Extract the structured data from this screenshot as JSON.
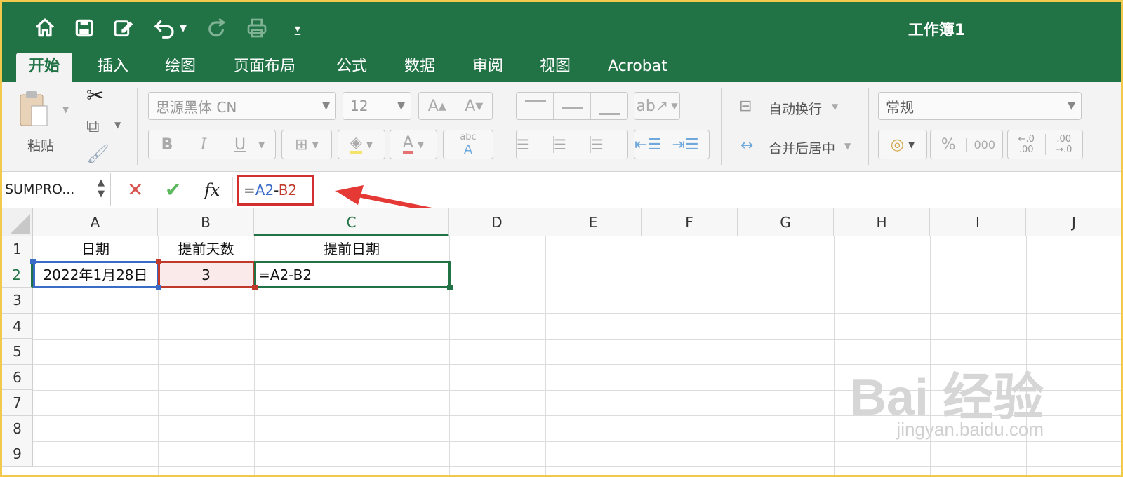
{
  "window": {
    "title": "工作簿1"
  },
  "tabs": [
    "开始",
    "插入",
    "绘图",
    "页面布局",
    "公式",
    "数据",
    "审阅",
    "视图",
    "Acrobat"
  ],
  "ribbon": {
    "paste_label": "粘贴",
    "font_name": "思源黑体 CN",
    "font_size": "12",
    "wrap_text": "自动换行",
    "merge_center": "合并后居中",
    "number_format": "常规",
    "bold": "B",
    "italic": "I",
    "underline": "U",
    "percent": "%",
    "thousands": "000",
    "abc": "abc"
  },
  "formula_bar": {
    "name_box": "SUMPRO...",
    "fx": "fx",
    "formula_eq": "=",
    "formula_ref_a": "A2",
    "formula_minus": "-",
    "formula_ref_b": "B2"
  },
  "grid": {
    "columns": [
      "A",
      "B",
      "C",
      "D",
      "E",
      "F",
      "G",
      "H",
      "I",
      "J"
    ],
    "rows": [
      "1",
      "2",
      "3",
      "4",
      "5",
      "6",
      "7",
      "8",
      "9"
    ],
    "cells": {
      "A1": "日期",
      "B1": "提前天数",
      "C1": "提前日期",
      "A2": "2022年1月28日",
      "B2": "3",
      "C2": "=A2-B2"
    }
  },
  "watermark": {
    "brand": "Bai 经验",
    "url": "jingyan.baidu.com"
  },
  "colors": {
    "accent": "#217346",
    "ref_a": "#3a6cc7",
    "ref_b": "#c0392b",
    "callout": "#d32f2f"
  }
}
